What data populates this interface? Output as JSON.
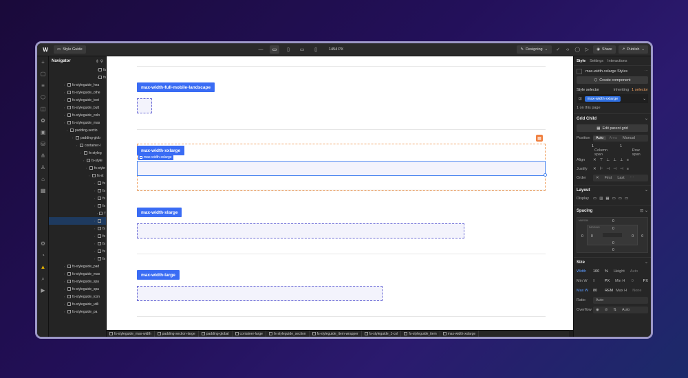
{
  "topbar": {
    "page": "Style Guide",
    "width": "1454 PX",
    "mode": "Designing",
    "share": "Share",
    "publish": "Publish"
  },
  "navigator": {
    "title": "Navigator",
    "rows": [
      {
        "indent": 70,
        "label": "fs"
      },
      {
        "indent": 70,
        "label": "fs"
      },
      {
        "indent": 22,
        "label": "fs-styleguide_hea"
      },
      {
        "indent": 22,
        "label": "fs-styleguide_othe"
      },
      {
        "indent": 22,
        "label": "fs-styleguide_text"
      },
      {
        "indent": 22,
        "label": "fs-styleguide_butt"
      },
      {
        "indent": 22,
        "label": "fs-styleguide_colo"
      },
      {
        "indent": 22,
        "label": "fs-styleguide_mas"
      },
      {
        "indent": 26,
        "label": "padding-sectio"
      },
      {
        "indent": 34,
        "label": "padding-glob"
      },
      {
        "indent": 40,
        "label": "container-l"
      },
      {
        "indent": 46,
        "label": "fs-styleg"
      },
      {
        "indent": 50,
        "label": "fs-style"
      },
      {
        "indent": 54,
        "label": "fs-style"
      },
      {
        "indent": 58,
        "label": "fs-st"
      },
      {
        "indent": 66,
        "label": "fs"
      },
      {
        "indent": 66,
        "label": "fs"
      },
      {
        "indent": 66,
        "label": "fs"
      },
      {
        "indent": 66,
        "label": "fs"
      },
      {
        "indent": 70,
        "label": "T"
      },
      {
        "indent": 66,
        "label": "",
        "sel": true
      },
      {
        "indent": 66,
        "label": "fs"
      },
      {
        "indent": 66,
        "label": "fs"
      },
      {
        "indent": 66,
        "label": "fs"
      },
      {
        "indent": 66,
        "label": "fs"
      },
      {
        "indent": 66,
        "label": "fs"
      },
      {
        "indent": 22,
        "label": "fs-styleguide_pad"
      },
      {
        "indent": 22,
        "label": "fs-styleguide_max"
      },
      {
        "indent": 22,
        "label": "fs-styleguide_spa"
      },
      {
        "indent": 22,
        "label": "fs-styleguide_spa"
      },
      {
        "indent": 22,
        "label": "fs-styleguide_icon"
      },
      {
        "indent": 22,
        "label": "fs-styleguide_utili"
      },
      {
        "indent": 22,
        "label": "fs-styleguide_pa"
      }
    ]
  },
  "canvas": {
    "tags": [
      "max-width-full-mobile-landscape",
      "max-width-xxlarge",
      "max-width-xlarge",
      "max-width-large"
    ],
    "inner_label": "max-width-xxlarge"
  },
  "breadcrumbs": [
    "fs-styleguide_max-width",
    "padding-section-large",
    "padding-global",
    "container-large",
    "fs-styleguide_section",
    "fs-styleguide_item-wrapper",
    "fs-styleguide_1-col",
    "fs-styleguide_item",
    "max-width-xxlarge"
  ],
  "panel": {
    "tabs": [
      "Style",
      "Settings",
      "Interactions"
    ],
    "styles_name": "max-width-xxlarge Styles",
    "create_component": "Create component",
    "style_selector": "Style selector",
    "inheriting": "Inheriting",
    "inheriting_count": "1 selector",
    "selector_chip": "max-width-xxlarge",
    "on_page": "1 on this page",
    "grid_child": "Grid Child",
    "edit_parent": "Edit parent grid",
    "position": "Position",
    "pos_opts": [
      "Auto",
      "Area",
      "Manual"
    ],
    "col_span_val": "1",
    "row_span_val": "1",
    "col_span": "Column span",
    "row_span": "Row span",
    "align": "Align",
    "justify": "Justify",
    "order": "Order",
    "order_opts": [
      "First",
      "Last"
    ],
    "layout": "Layout",
    "display": "Display",
    "spacing": "Spacing",
    "margin": "MARGIN",
    "padding": "PADDING",
    "size": "Size",
    "width_l": "Width",
    "width_v": "100",
    "width_u": "%",
    "height_l": "Height",
    "height_v": "Auto",
    "minw_l": "Min W",
    "minw_v": "0",
    "minw_u": "PX",
    "minh_l": "Min H",
    "minh_v": "0",
    "minh_u": "PX",
    "maxw_l": "Max W",
    "maxw_v": "80",
    "maxw_u": "REM",
    "maxh_l": "Max H",
    "maxh_v": "None",
    "ratio_l": "Ratio",
    "ratio_v": "Auto",
    "overflow_l": "Overflow",
    "overflow_v": "Auto"
  },
  "colors": {
    "accent": "#3a6cf4",
    "selection": "#f0a060"
  }
}
